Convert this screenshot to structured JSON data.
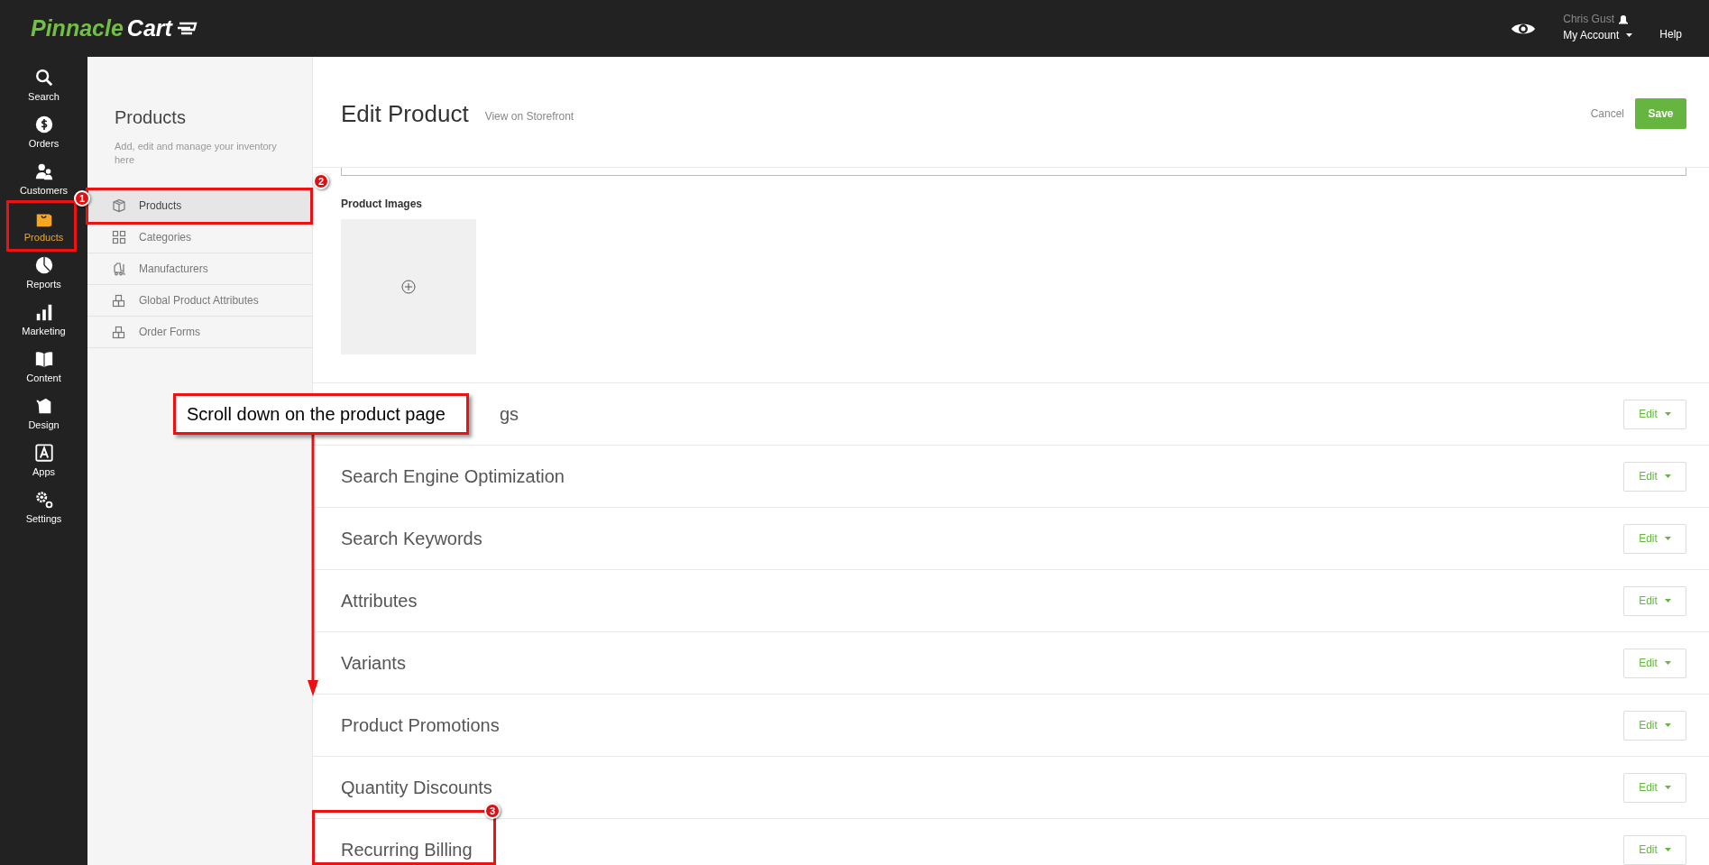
{
  "topbar": {
    "logo": {
      "first": "Pinnacle",
      "second": "Cart"
    },
    "user": "Chris Gust",
    "account": "My Account",
    "help": "Help"
  },
  "nav": [
    {
      "label": "Search",
      "selected": false
    },
    {
      "label": "Orders",
      "selected": false
    },
    {
      "label": "Customers",
      "selected": false
    },
    {
      "label": "Products",
      "selected": true
    },
    {
      "label": "Reports",
      "selected": false
    },
    {
      "label": "Marketing",
      "selected": false
    },
    {
      "label": "Content",
      "selected": false
    },
    {
      "label": "Design",
      "selected": false
    },
    {
      "label": "Apps",
      "selected": false
    },
    {
      "label": "Settings",
      "selected": false
    }
  ],
  "subnav": {
    "title": "Products",
    "description": "Add, edit and manage your inventory here",
    "items": [
      {
        "label": "Products",
        "selected": true
      },
      {
        "label": "Categories",
        "selected": false
      },
      {
        "label": "Manufacturers",
        "selected": false
      },
      {
        "label": "Global Product Attributes",
        "selected": false
      },
      {
        "label": "Order Forms",
        "selected": false
      }
    ]
  },
  "page": {
    "title": "Edit Product",
    "storefront_link": "View on Storefront",
    "cancel": "Cancel",
    "save": "Save",
    "images_label": "Product Images"
  },
  "sections": [
    {
      "title": "gs",
      "button": "Edit"
    },
    {
      "title": "Search Engine Optimization",
      "button": "Edit"
    },
    {
      "title": "Search Keywords",
      "button": "Edit"
    },
    {
      "title": "Attributes",
      "button": "Edit"
    },
    {
      "title": "Variants",
      "button": "Edit"
    },
    {
      "title": "Product Promotions",
      "button": "Edit"
    },
    {
      "title": "Quantity Discounts",
      "button": "Edit"
    },
    {
      "title": "Recurring Billing",
      "button": "Edit"
    }
  ],
  "annotations": {
    "callout": "Scroll down on the product page",
    "badges": [
      "1",
      "2",
      "3"
    ]
  }
}
